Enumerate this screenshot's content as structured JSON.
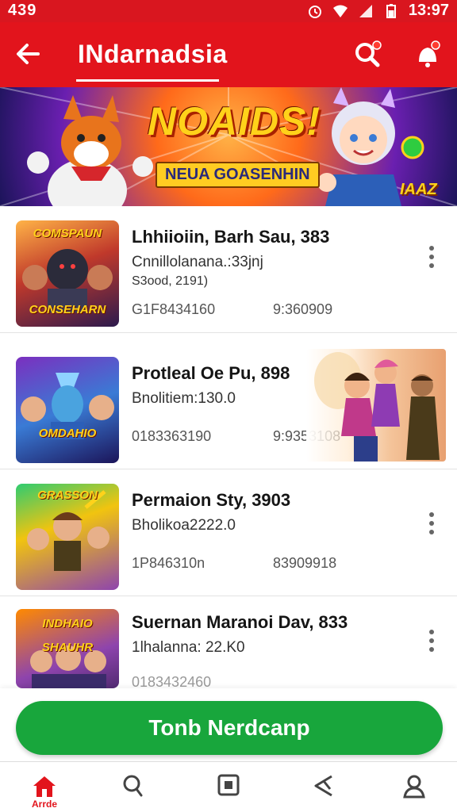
{
  "status_bar": {
    "left_text": "439",
    "clock": "13:97"
  },
  "app_bar": {
    "title": "INdarnadsia"
  },
  "banner": {
    "headline": "NOAIDS!",
    "subline": "NEUA GOASENHIN",
    "corner_tag": "IAAZ"
  },
  "games": [
    {
      "thumb_top_label": "COMSPAUN",
      "thumb_bottom_label": "CONSEHARN",
      "title": "Lhhiioiin, Barh Sau, 383",
      "subtitle": "Cnnillolanana.:33jnj",
      "subtitle2": "S3ood, 2191)",
      "meta_a": "G1F8434160",
      "meta_b": "9:360909"
    },
    {
      "thumb_bottom_label": "OMDAHIO",
      "title": "Protleal Oe Pu, 898",
      "subtitle": "Bnolitiem:130.0",
      "meta_a": "0183363190",
      "meta_b": "9:9353108"
    },
    {
      "thumb_top_label": "GRASSON",
      "title": "Permaion Sty, 3903",
      "subtitle": "Bholikoa2222.0",
      "meta_a": "1P846310n",
      "meta_b": "83909918"
    },
    {
      "thumb_top_label": "INDHAIO",
      "thumb_bottom_label": "SHAUHR",
      "title": "Suernan Maranoi Dav, 833",
      "subtitle": "1lhalanna: 22.K0",
      "meta_a": "0183432460"
    }
  ],
  "cta": {
    "label": "Tonb Nerdcanp"
  },
  "bottom_nav": {
    "home_label": "Arrde"
  },
  "colors": {
    "brand_red": "#e2141c",
    "cta_green": "#18a63c"
  }
}
